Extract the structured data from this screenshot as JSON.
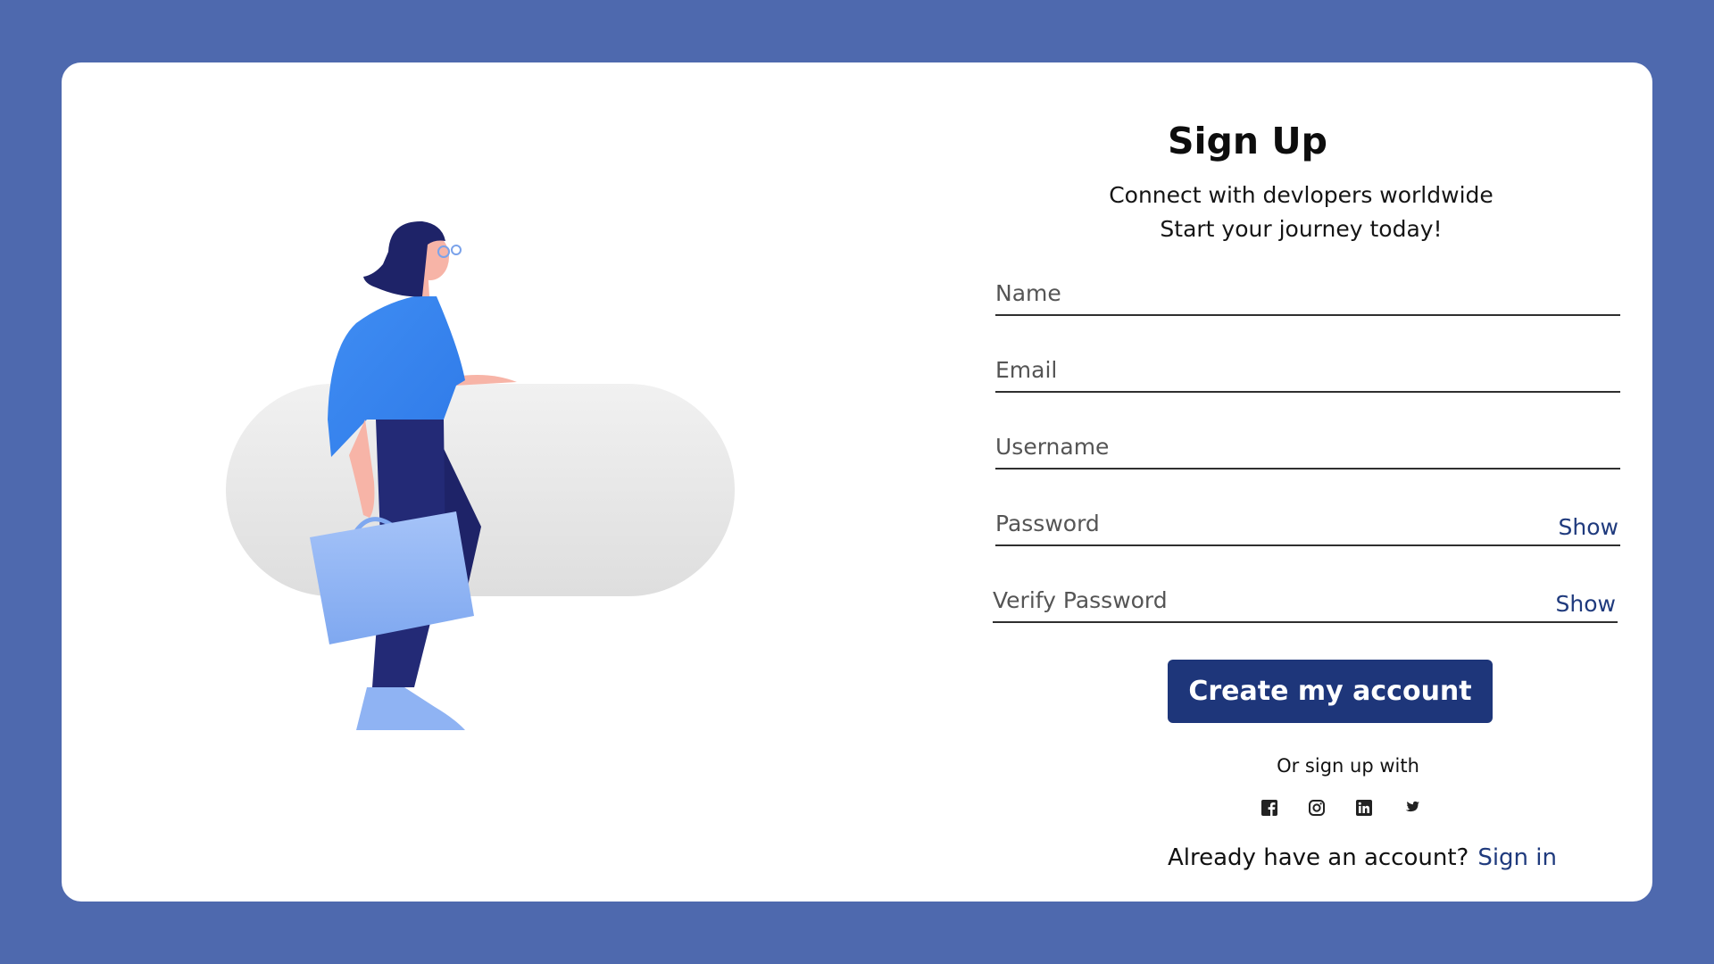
{
  "title": "Sign Up",
  "subtitle_line1": "Connect with devlopers worldwide",
  "subtitle_line2": "Start your journey today!",
  "fields": {
    "name": {
      "placeholder": "Name",
      "value": ""
    },
    "email": {
      "placeholder": "Email",
      "value": ""
    },
    "username": {
      "placeholder": "Username",
      "value": ""
    },
    "password": {
      "placeholder": "Password",
      "value": "",
      "toggle_label": "Show"
    },
    "verify_password": {
      "placeholder": "Verify Password",
      "value": "",
      "toggle_label": "Show"
    }
  },
  "submit_label": "Create my account",
  "social": {
    "prompt": "Or sign up with",
    "icons": [
      "facebook-icon",
      "instagram-icon",
      "linkedin-icon",
      "twitter-icon"
    ]
  },
  "footer": {
    "text": "Already have an account?",
    "link": "Sign in"
  },
  "colors": {
    "background": "#4e69ae",
    "card": "#ffffff",
    "button": "#1e367a",
    "link": "#1f3a7d"
  }
}
